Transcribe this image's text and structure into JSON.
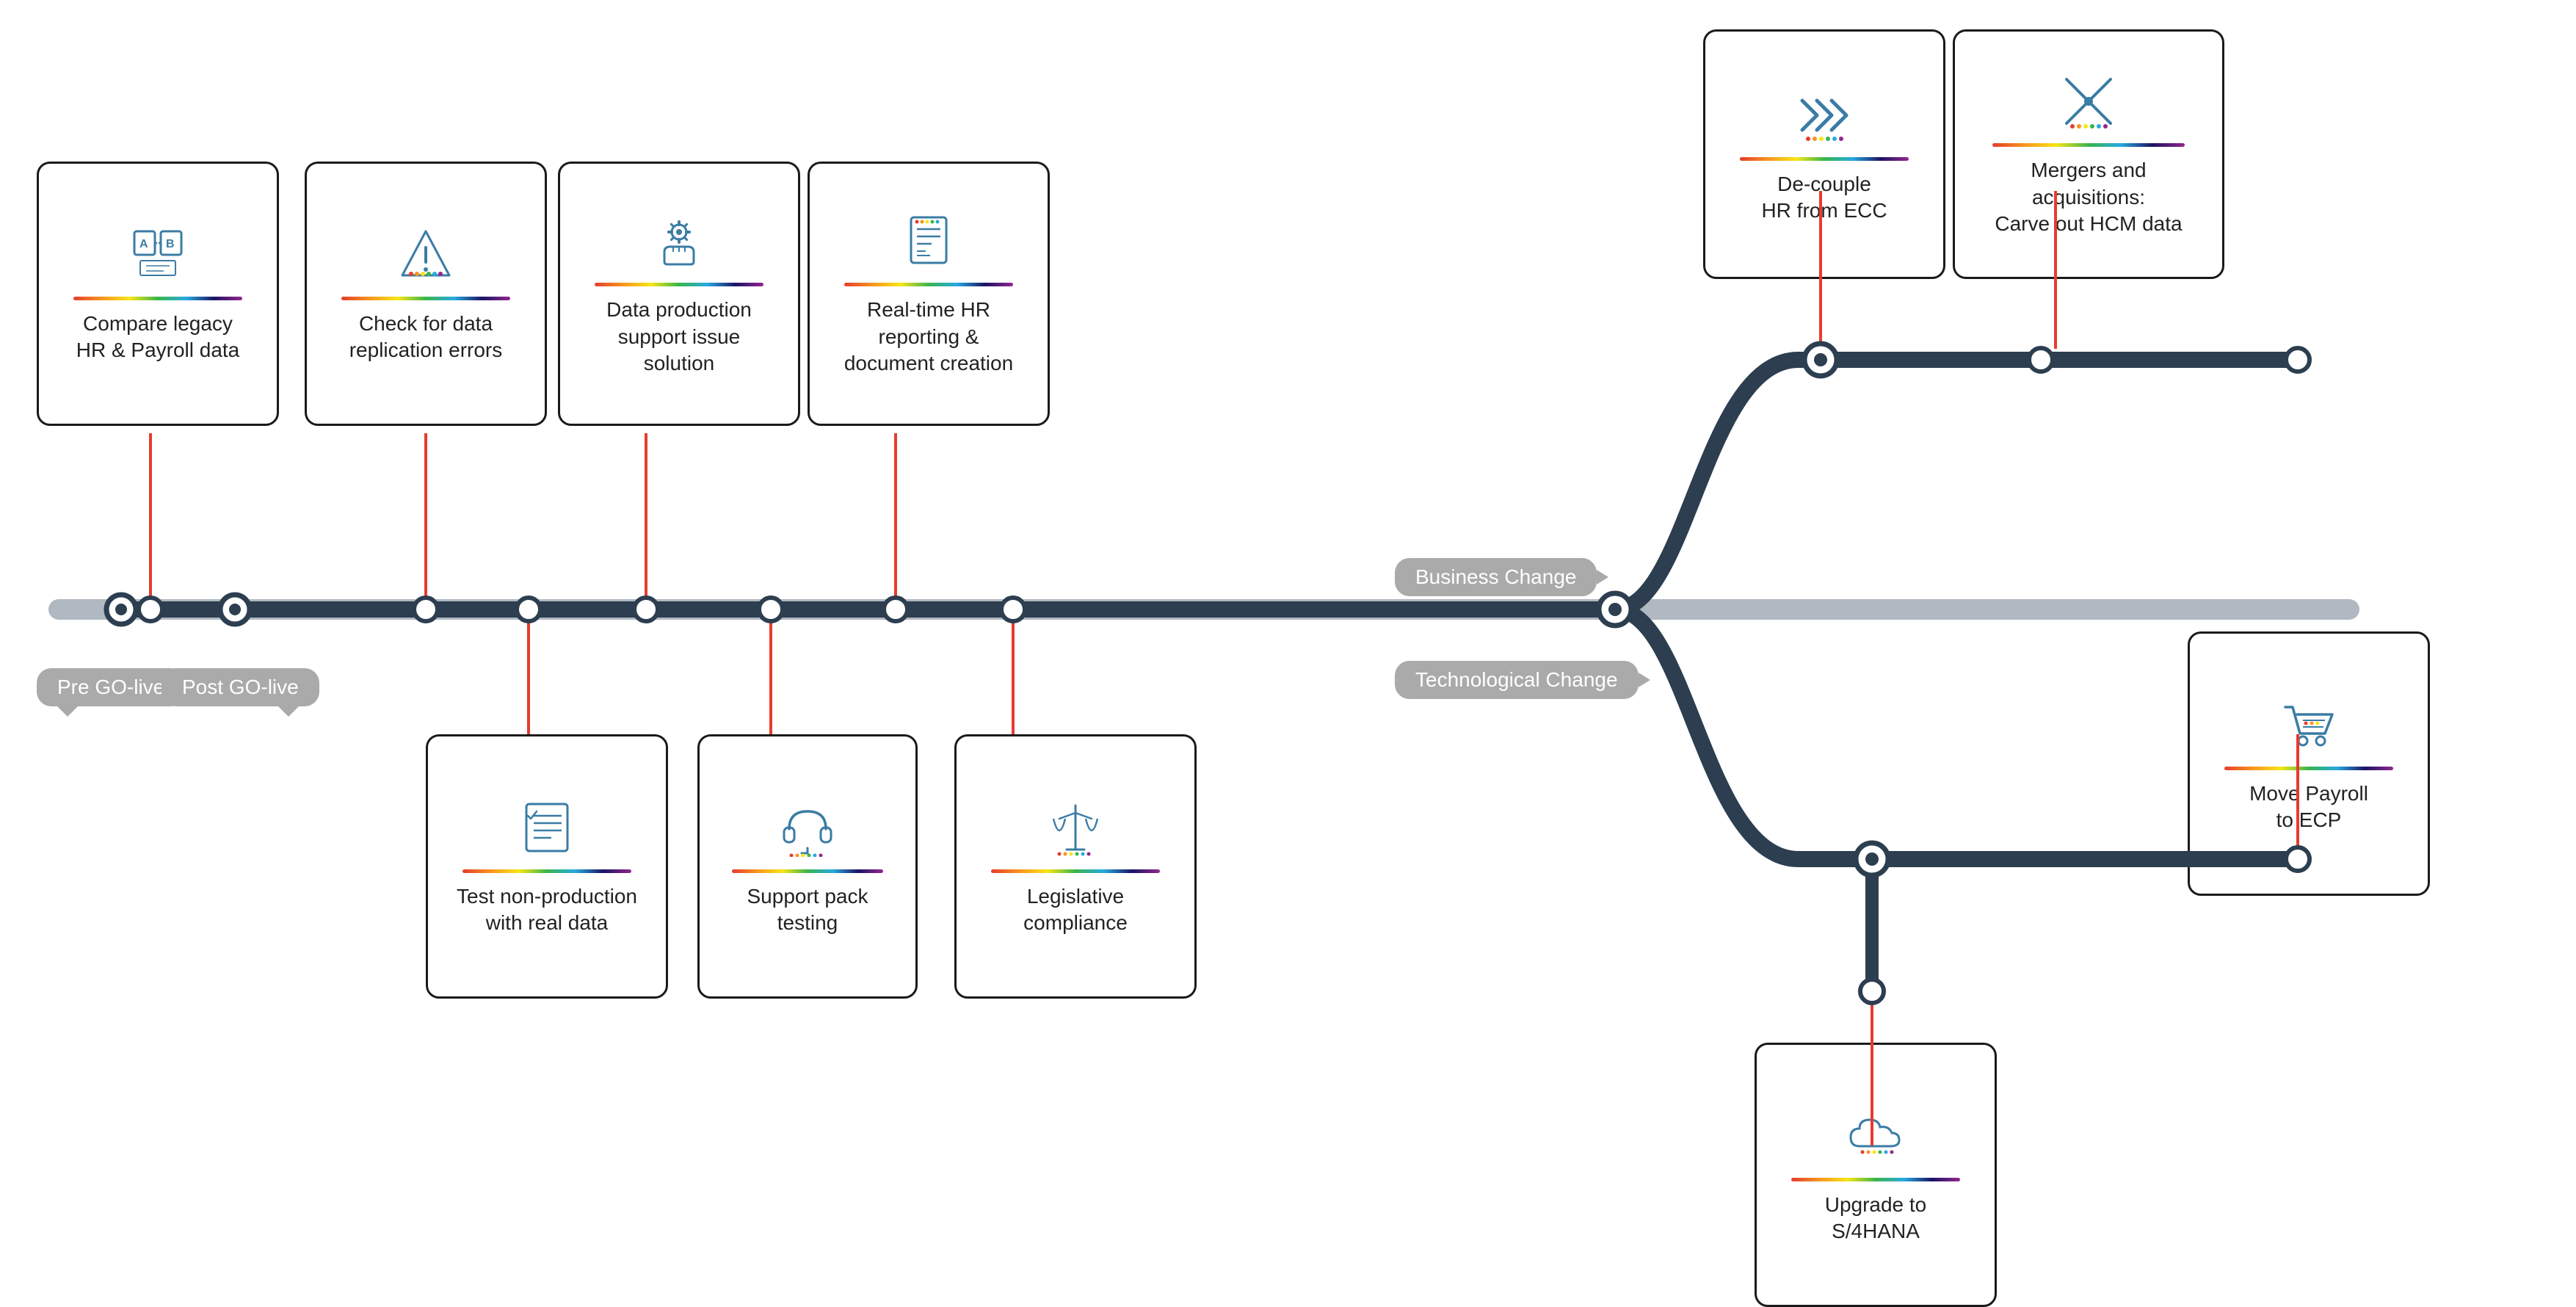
{
  "cards": {
    "compare_legacy": {
      "label": "Compare legacy\nHR & Payroll data",
      "icon": "ab"
    },
    "check_data": {
      "label": "Check for data\nreplication errors",
      "icon": "warning"
    },
    "data_production": {
      "label": "Data production\nsupport issue\nsolution",
      "icon": "gear_hand"
    },
    "realtime_hr": {
      "label": "Real-time HR\nreporting &\ndocument creation",
      "icon": "document"
    },
    "decouple": {
      "label": "De-couple\nHR from ECC",
      "icon": "arrows"
    },
    "mergers": {
      "label": "Mergers and\nacquisitions:\nCarve out HCM data",
      "icon": "merge"
    },
    "test_nonprod": {
      "label": "Test non-production\nwith real data",
      "icon": "checklist"
    },
    "support_pack": {
      "label": "Support pack\ntesting",
      "icon": "headset"
    },
    "legislative": {
      "label": "Legislative\ncompliance",
      "icon": "scale"
    },
    "upgrade": {
      "label": "Upgrade to\nS/4HANA",
      "icon": "cloud"
    },
    "move_payroll": {
      "label": "Move Payroll\nto ECP",
      "icon": "cart"
    }
  },
  "phase_labels": {
    "pre_golive": "Pre GO-live",
    "post_golive": "Post GO-live",
    "business_change": "Business Change",
    "technological_change": "Technological Change"
  }
}
